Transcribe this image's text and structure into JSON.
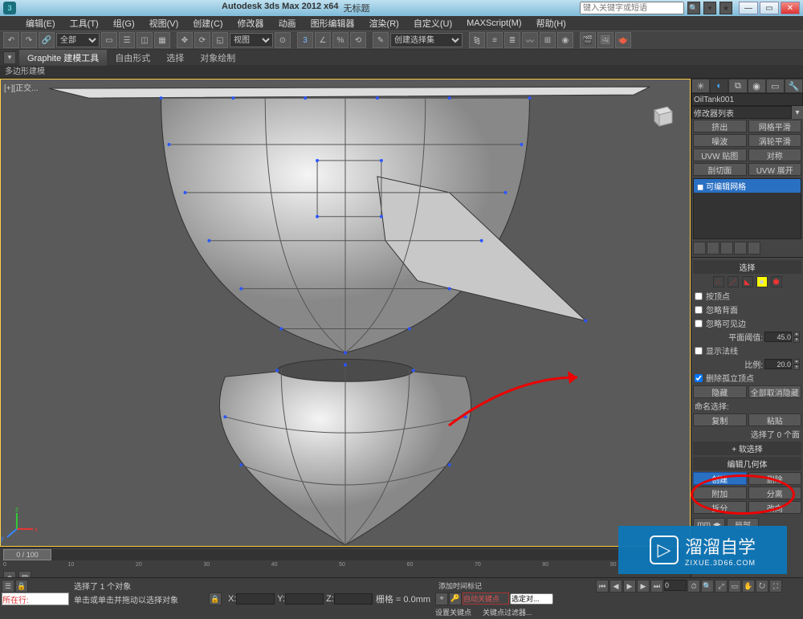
{
  "app": {
    "name": "Autodesk 3ds Max  2012  x64",
    "doc": "无标题",
    "search_placeholder": "键入关键字或短语"
  },
  "menu": [
    "编辑(E)",
    "工具(T)",
    "组(G)",
    "视图(V)",
    "创建(C)",
    "修改器",
    "动画",
    "图形编辑器",
    "渲染(R)",
    "自定义(U)",
    "MAXScript(M)",
    "帮助(H)"
  ],
  "toolbar": {
    "selset_label": "全部",
    "view_label": "视图",
    "named_sel": "创建选择集"
  },
  "ribbon": {
    "tabs": [
      "Graphite 建模工具",
      "自由形式",
      "选择",
      "对象绘制"
    ],
    "sub": "多边形建模"
  },
  "viewport": {
    "label": "[+][正交..."
  },
  "cmd": {
    "obj_name": "OilTank001",
    "modlist": "修改器列表",
    "mods": {
      "a1": "挤出",
      "a2": "网格平滑",
      "b1": "噪波",
      "b2": "涡轮平滑",
      "c1": "UVW 贴图",
      "c2": "对称",
      "d1": "剖切面",
      "d2": "UVW 展开"
    },
    "stack_item": "可编辑网格",
    "roll_sel": "选择",
    "by_vertex": "按顶点",
    "ignore_back": "忽略背面",
    "ignore_vis": "忽略可见边",
    "plane_thresh": "平面阈值:",
    "plane_val": "45.0",
    "show_norm": "显示法线",
    "scale_lbl": "比例:",
    "scale_val": "20.0",
    "del_iso": "删除孤立顶点",
    "hide": "隐藏",
    "unhide": "全部取消隐藏",
    "named_sel_lbl": "命名选择:",
    "copy": "复制",
    "paste": "粘贴",
    "sel_count": "选择了 0 个面",
    "roll_soft": "软选择",
    "roll_geo": "编辑几何体",
    "create": "创建",
    "delete": "删除",
    "attach": "附加",
    "detach": "分离",
    "split": "拆分",
    "turn": "改向",
    "local": "局部"
  },
  "timeline": {
    "pos": "0 / 100"
  },
  "status": {
    "nowgo": "所在行:",
    "msg1": "选择了 1 个对象",
    "msg2": "单击或单击并拖动以选择对象",
    "x": "X:",
    "y": "Y:",
    "z": "Z:",
    "grid": "栅格 = 0.0mm",
    "addtag": "添加时间标记",
    "autokey": "自动关键点",
    "selset": "选定对...",
    "setkey": "设置关键点",
    "keyfilt": "关键点过滤器..."
  },
  "wm": {
    "big": "溜溜自学",
    "sub": "ZIXUE.3D66.COM"
  }
}
